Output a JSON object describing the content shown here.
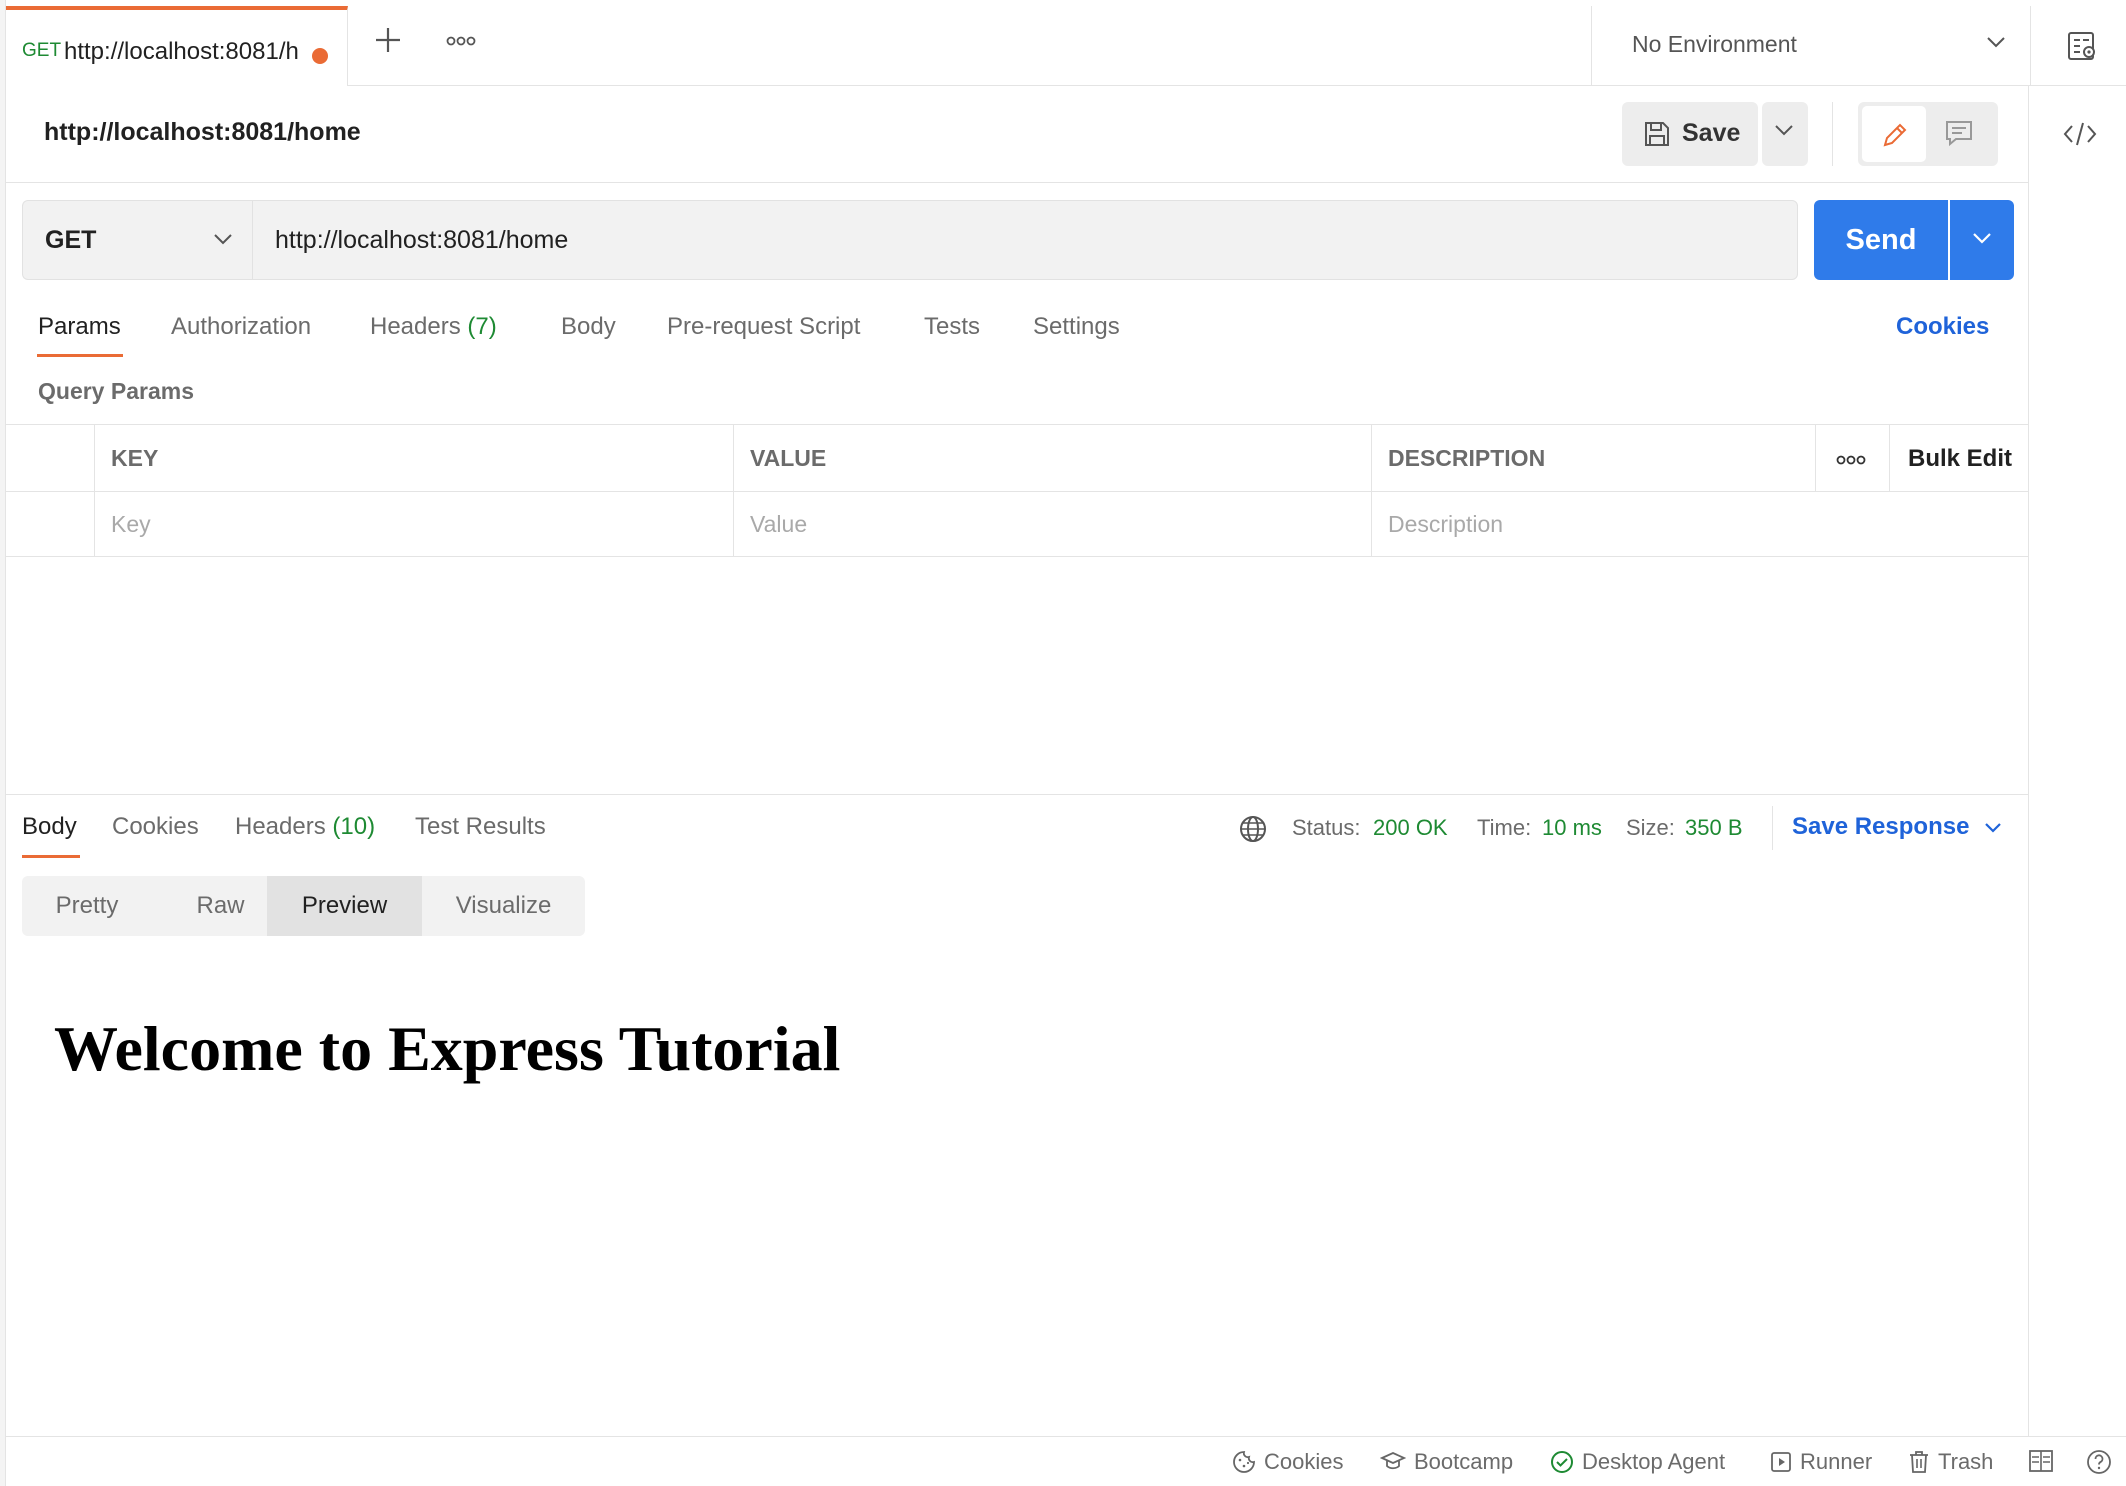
{
  "tab": {
    "method": "GET",
    "title": "http://localhost:8081/h"
  },
  "environment": {
    "selected": "No Environment"
  },
  "request": {
    "title": "http://localhost:8081/home",
    "save_label": "Save",
    "method": "GET",
    "url": "http://localhost:8081/home",
    "send_label": "Send"
  },
  "request_tabs": {
    "params": "Params",
    "authorization": "Authorization",
    "headers": "Headers",
    "headers_count": "(7)",
    "body": "Body",
    "pre_request": "Pre-request Script",
    "tests": "Tests",
    "settings": "Settings",
    "cookies": "Cookies"
  },
  "params": {
    "section_title": "Query Params",
    "columns": [
      "KEY",
      "VALUE",
      "DESCRIPTION"
    ],
    "bulk_edit": "Bulk Edit",
    "placeholders": [
      "Key",
      "Value",
      "Description"
    ]
  },
  "response": {
    "tabs": {
      "body": "Body",
      "cookies": "Cookies",
      "headers": "Headers",
      "headers_count": "(10)",
      "test_results": "Test Results"
    },
    "status_label": "Status:",
    "status_value": "200 OK",
    "time_label": "Time:",
    "time_value": "10 ms",
    "size_label": "Size:",
    "size_value": "350 B",
    "save_response": "Save Response",
    "views": [
      "Pretty",
      "Raw",
      "Preview",
      "Visualize"
    ],
    "active_view": "Preview",
    "preview_heading": "Welcome to Express Tutorial"
  },
  "statusbar": {
    "cookies": "Cookies",
    "bootcamp": "Bootcamp",
    "desktop_agent": "Desktop Agent",
    "runner": "Runner",
    "trash": "Trash"
  },
  "colors": {
    "accent": "#ea6b35",
    "primary": "#2f7bea",
    "link": "#1f63d9",
    "success": "#1e8a33"
  }
}
